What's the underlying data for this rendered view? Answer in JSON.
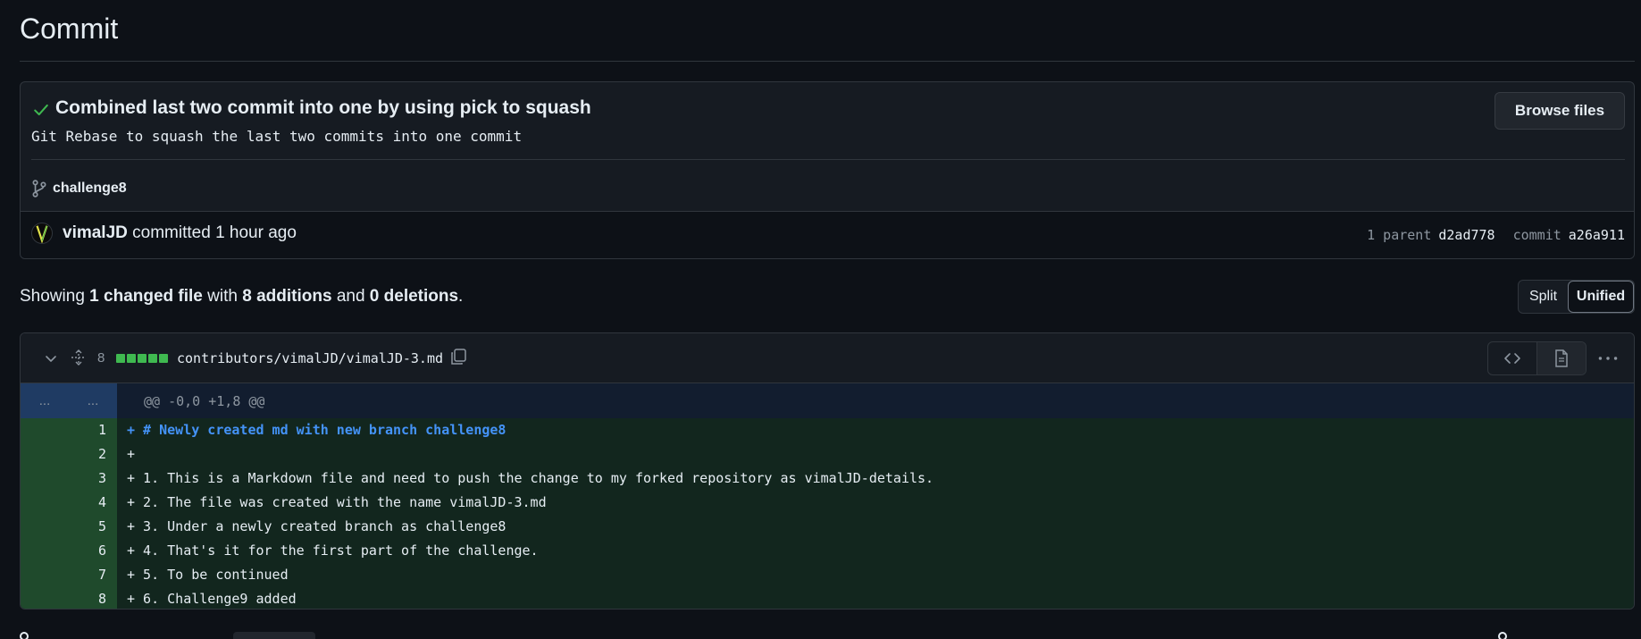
{
  "page": {
    "title": "Commit"
  },
  "commit": {
    "title": "Combined last two commit into one by using pick to squash",
    "description": "Git Rebase to squash the last two commits into one commit",
    "browse_label": "Browse files",
    "branch": "challenge8",
    "author": "vimalJD",
    "action": "committed",
    "time": "1 hour ago",
    "parent_label": "1 parent",
    "parent_sha": "d2ad778",
    "commit_label": "commit",
    "commit_sha": "a26a911"
  },
  "summary": {
    "prefix": "Showing",
    "files": "1 changed file",
    "with": "with",
    "additions": "8 additions",
    "and": "and",
    "deletions": "0 deletions",
    "period": "."
  },
  "view_toggle": {
    "split": "Split",
    "unified": "Unified",
    "selected": "Unified"
  },
  "file": {
    "additions_count": "8",
    "path": "contributors/vimalJD/vimalJD-3.md",
    "hunk": {
      "left": "...",
      "right": "...",
      "header": "@@ -0,0 +1,8 @@"
    },
    "lines": [
      {
        "num": "1",
        "text": "+ # Newly created md with new branch challenge8"
      },
      {
        "num": "2",
        "text": "+"
      },
      {
        "num": "3",
        "text": "+ 1. This is a Markdown file and need to push the change to my forked repository as vimalJD-details."
      },
      {
        "num": "4",
        "text": "+ 2. The file was created with the name vimalJD-3.md"
      },
      {
        "num": "5",
        "text": "+ 3. Under a newly created branch as challenge8"
      },
      {
        "num": "6",
        "text": "+ 4. That's it for the first part of the challenge."
      },
      {
        "num": "7",
        "text": "+ 5. To be continued"
      },
      {
        "num": "8",
        "text": "+ 6. Challenge9 added"
      }
    ]
  },
  "colors": {
    "background": "#0d1117",
    "success": "#3fb950",
    "heading_blue": "#4493f8"
  },
  "icons": [
    "check-icon",
    "branch-icon",
    "chevron-down-icon",
    "expand-icon",
    "copy-icon",
    "code-icon",
    "file-icon",
    "kebab-icon"
  ]
}
